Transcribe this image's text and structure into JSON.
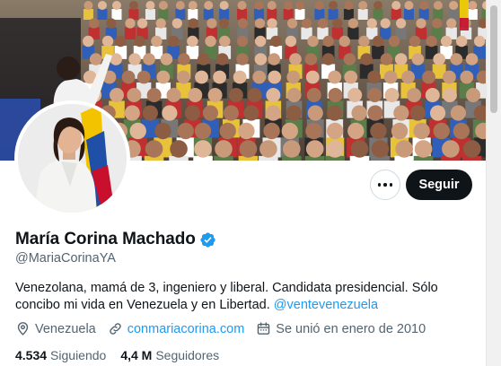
{
  "profile": {
    "name": "María Corina Machado",
    "handle": "@MariaCorinaYA",
    "bio_text": "Venezolana, mamá de 3, ingeniero y liberal. Candidata presidencial. Sólo concibo mi vida en Venezuela y en Libertad. ",
    "bio_mention": "@ventevenezuela",
    "location": "Venezuela",
    "website": "conmariacorina.com",
    "joined": "Se unió en enero de 2010"
  },
  "actions": {
    "follow_label": "Seguir"
  },
  "stats": {
    "following_count": "4.534",
    "following_label": "Siguiendo",
    "followers_count": "4,4 M",
    "followers_label": "Seguidores"
  },
  "colors": {
    "accent": "#1d9bf0",
    "text_primary": "#0f1419",
    "text_secondary": "#536471",
    "button_dark": "#0f1419"
  },
  "icons": {
    "verified": "verified-badge-icon",
    "more": "more-dots-icon",
    "location": "location-pin-icon",
    "link": "link-icon",
    "calendar": "calendar-icon"
  }
}
